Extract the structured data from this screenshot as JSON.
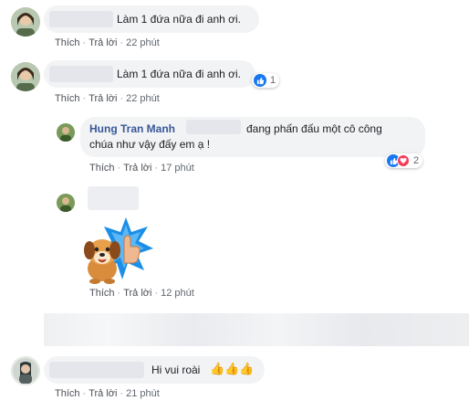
{
  "colors": {
    "accent": "#385898",
    "bubble": "#f2f3f5",
    "like": "#1877f2",
    "love": "#f33e58"
  },
  "actions": {
    "like": "Thích",
    "reply": "Trả lời",
    "sep": "·"
  },
  "comments": [
    {
      "text": "Làm 1 đứa nữa đi anh ơi.",
      "time": "22 phút"
    },
    {
      "text": "Làm 1 đứa nữa đi anh ơi.",
      "time": "22 phút",
      "reactions": {
        "count": "1",
        "types": [
          "like-icon"
        ]
      }
    }
  ],
  "replies": [
    {
      "author": "Hung Tran Manh",
      "text_line1": "đang phấn đấu một cô công",
      "text_line2": "chúa như vậy đấy em ạ !",
      "time": "17 phút",
      "reactions": {
        "count": "2",
        "types": [
          "like-icon",
          "love-icon"
        ]
      }
    },
    {
      "sticker": "dog-thumbs-up-sticker",
      "time": "12 phút"
    }
  ],
  "last_comment": {
    "text": "Hi vui roài",
    "emoji": "👍👍👍",
    "time": "21 phút"
  }
}
